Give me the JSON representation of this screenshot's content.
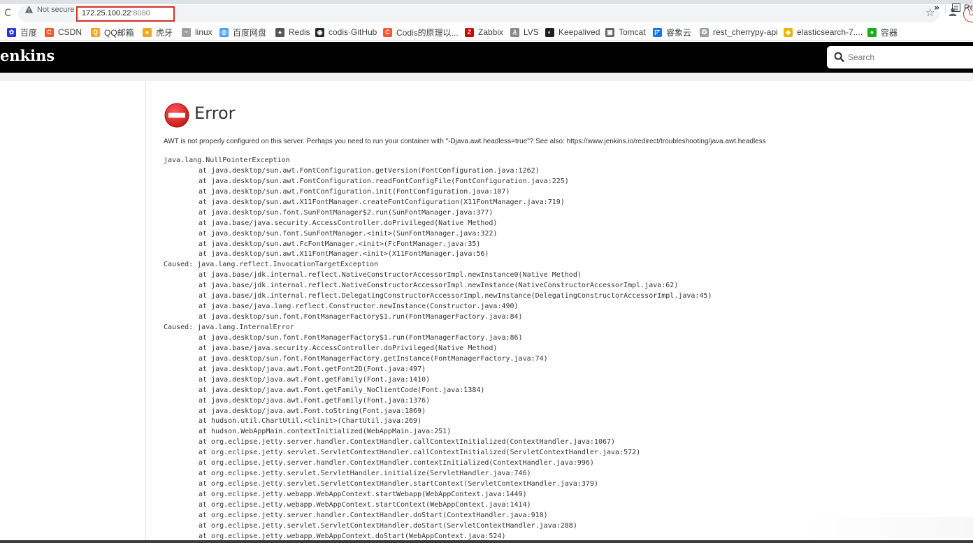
{
  "browser": {
    "reload_icon": "reload-icon",
    "security_label": "Not secure",
    "url_host": "172.25.100.22",
    "url_port": ":8080",
    "update_label": "U",
    "bookmarks": [
      {
        "label": "百度",
        "icon": "baidu-icon",
        "color": "#2932e1"
      },
      {
        "label": "CSDN",
        "icon": "csdn-icon",
        "color": "#fc5531"
      },
      {
        "label": "QQ邮箱",
        "icon": "qq-mail-icon",
        "color": "#f5a623"
      },
      {
        "label": "虎牙",
        "icon": "huya-icon",
        "color": "#f5a623"
      },
      {
        "label": "linux",
        "icon": "linux-icon",
        "color": "#9aa0a6"
      },
      {
        "label": "百度网盘",
        "icon": "baidu-pan-icon",
        "color": "#4aa5ff"
      },
      {
        "label": "Redis",
        "icon": "redis-icon",
        "color": "#555555"
      },
      {
        "label": "codis·GitHub",
        "icon": "github-icon",
        "color": "#24292e"
      },
      {
        "label": "Codis的原理以...",
        "icon": "csdn-icon",
        "color": "#fc5531"
      },
      {
        "label": "Zabbix",
        "icon": "zabbix-icon",
        "color": "#d40000"
      },
      {
        "label": "LVS",
        "icon": "lvs-icon",
        "color": "#888888"
      },
      {
        "label": "Keepalived",
        "icon": "keepalived-icon",
        "color": "#202124"
      },
      {
        "label": "Tomcat",
        "icon": "tomcat-icon",
        "color": "#666666"
      },
      {
        "label": "睿象云",
        "icon": "ruixiang-icon",
        "color": "#1a73e8"
      },
      {
        "label": "rest_cherrypy-api",
        "icon": "saltstack-icon",
        "color": "#9aa0a6"
      },
      {
        "label": "elasticsearch-7....",
        "icon": "elasticsearch-icon",
        "color": "#f0b400"
      },
      {
        "label": "容器",
        "icon": "wechat-icon",
        "color": "#1aad19"
      }
    ],
    "more_label": "»",
    "reading_list_label": "Re"
  },
  "header": {
    "logo": "enkins",
    "search_placeholder": "Search"
  },
  "error": {
    "title": "Error",
    "message": "AWT is not properly configured on this server. Perhaps you need to run your container with \"-Djava.awt.headless=true\"? See also: https://www.jenkins.io/redirect/troubleshooting/java.awt.headless",
    "stack": [
      {
        "text": "java.lang.NullPointerException",
        "frame": false
      },
      {
        "text": "at java.desktop/sun.awt.FontConfiguration.getVersion(FontConfiguration.java:1262)",
        "frame": true
      },
      {
        "text": "at java.desktop/sun.awt.FontConfiguration.readFontConfigFile(FontConfiguration.java:225)",
        "frame": true
      },
      {
        "text": "at java.desktop/sun.awt.FontConfiguration.init(FontConfiguration.java:107)",
        "frame": true
      },
      {
        "text": "at java.desktop/sun.awt.X11FontManager.createFontConfiguration(X11FontManager.java:719)",
        "frame": true
      },
      {
        "text": "at java.desktop/sun.font.SunFontManager$2.run(SunFontManager.java:377)",
        "frame": true
      },
      {
        "text": "at java.base/java.security.AccessController.doPrivileged(Native Method)",
        "frame": true
      },
      {
        "text": "at java.desktop/sun.font.SunFontManager.<init>(SunFontManager.java:322)",
        "frame": true
      },
      {
        "text": "at java.desktop/sun.awt.FcFontManager.<init>(FcFontManager.java:35)",
        "frame": true
      },
      {
        "text": "at java.desktop/sun.awt.X11FontManager.<init>(X11FontManager.java:56)",
        "frame": true
      },
      {
        "text": "Caused: java.lang.reflect.InvocationTargetException",
        "frame": false
      },
      {
        "text": "at java.base/jdk.internal.reflect.NativeConstructorAccessorImpl.newInstance0(Native Method)",
        "frame": true
      },
      {
        "text": "at java.base/jdk.internal.reflect.NativeConstructorAccessorImpl.newInstance(NativeConstructorAccessorImpl.java:62)",
        "frame": true
      },
      {
        "text": "at java.base/jdk.internal.reflect.DelegatingConstructorAccessorImpl.newInstance(DelegatingConstructorAccessorImpl.java:45)",
        "frame": true
      },
      {
        "text": "at java.base/java.lang.reflect.Constructor.newInstance(Constructor.java:490)",
        "frame": true
      },
      {
        "text": "at java.desktop/sun.font.FontManagerFactory$1.run(FontManagerFactory.java:84)",
        "frame": true
      },
      {
        "text": "Caused: java.lang.InternalError",
        "frame": false
      },
      {
        "text": "at java.desktop/sun.font.FontManagerFactory$1.run(FontManagerFactory.java:86)",
        "frame": true
      },
      {
        "text": "at java.base/java.security.AccessController.doPrivileged(Native Method)",
        "frame": true
      },
      {
        "text": "at java.desktop/sun.font.FontManagerFactory.getInstance(FontManagerFactory.java:74)",
        "frame": true
      },
      {
        "text": "at java.desktop/java.awt.Font.getFont2D(Font.java:497)",
        "frame": true
      },
      {
        "text": "at java.desktop/java.awt.Font.getFamily(Font.java:1410)",
        "frame": true
      },
      {
        "text": "at java.desktop/java.awt.Font.getFamily_NoClientCode(Font.java:1384)",
        "frame": true
      },
      {
        "text": "at java.desktop/java.awt.Font.getFamily(Font.java:1376)",
        "frame": true
      },
      {
        "text": "at java.desktop/java.awt.Font.toString(Font.java:1869)",
        "frame": true
      },
      {
        "text": "at hudson.util.ChartUtil.<clinit>(ChartUtil.java:269)",
        "frame": true
      },
      {
        "text": "at hudson.WebAppMain.contextInitialized(WebAppMain.java:251)",
        "frame": true
      },
      {
        "text": "at org.eclipse.jetty.server.handler.ContextHandler.callContextInitialized(ContextHandler.java:1067)",
        "frame": true
      },
      {
        "text": "at org.eclipse.jetty.servlet.ServletContextHandler.callContextInitialized(ServletContextHandler.java:572)",
        "frame": true
      },
      {
        "text": "at org.eclipse.jetty.server.handler.ContextHandler.contextInitialized(ContextHandler.java:996)",
        "frame": true
      },
      {
        "text": "at org.eclipse.jetty.servlet.ServletHandler.initialize(ServletHandler.java:746)",
        "frame": true
      },
      {
        "text": "at org.eclipse.jetty.servlet.ServletContextHandler.startContext(ServletContextHandler.java:379)",
        "frame": true
      },
      {
        "text": "at org.eclipse.jetty.webapp.WebAppContext.startWebapp(WebAppContext.java:1449)",
        "frame": true
      },
      {
        "text": "at org.eclipse.jetty.webapp.WebAppContext.startContext(WebAppContext.java:1414)",
        "frame": true
      },
      {
        "text": "at org.eclipse.jetty.server.handler.ContextHandler.doStart(ContextHandler.java:910)",
        "frame": true
      },
      {
        "text": "at org.eclipse.jetty.servlet.ServletContextHandler.doStart(ServletContextHandler.java:288)",
        "frame": true
      },
      {
        "text": "at org.eclipse.jetty.webapp.WebAppContext.doStart(WebAppContext.java:524)",
        "frame": true
      }
    ]
  },
  "colors": {
    "header_bg": "#000000",
    "error_red": "#e02020",
    "url_highlight": "#d93025"
  }
}
